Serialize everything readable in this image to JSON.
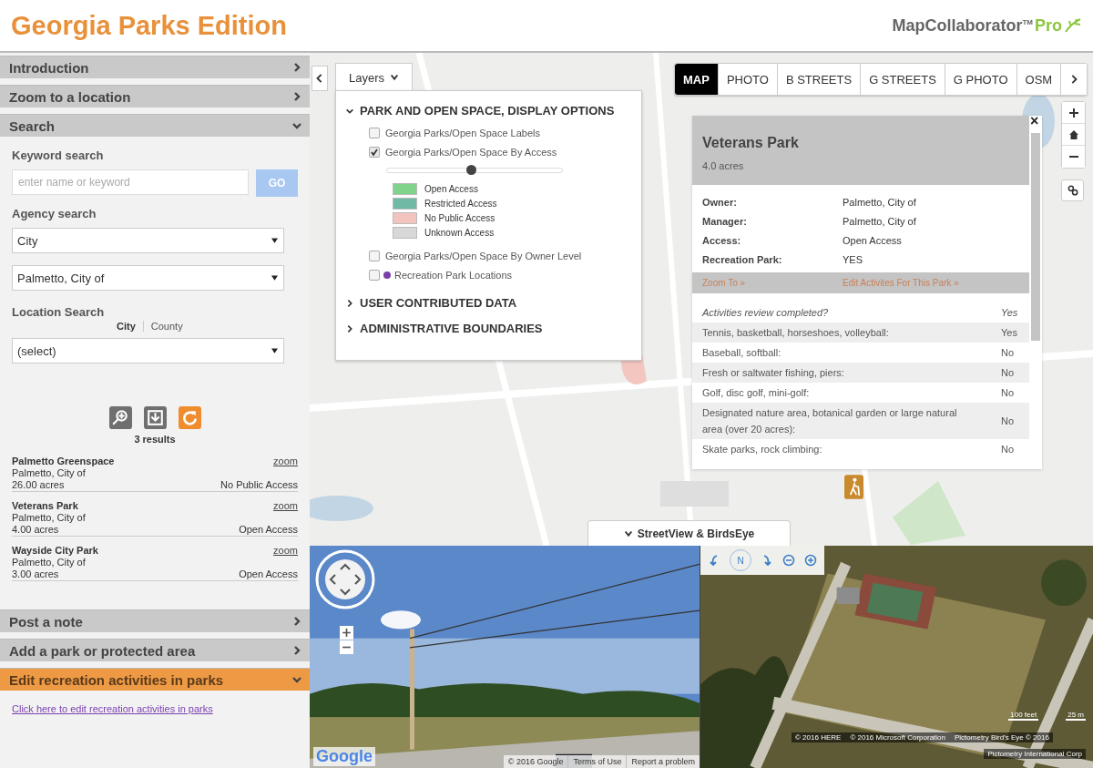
{
  "header": {
    "title": "Georgia Parks Edition",
    "logo_text": "MapCollaborator$^{TM}$",
    "logo_pro": "Pro"
  },
  "sidebar": {
    "sections": [
      {
        "title": "Introduction",
        "expanded": false,
        "active": false
      },
      {
        "title": "Zoom to a location",
        "expanded": false,
        "active": false
      },
      {
        "title": "Search",
        "expanded": true,
        "active": false,
        "kind": "search"
      },
      {
        "title": "Post a note",
        "expanded": false,
        "active": false
      },
      {
        "title": "Add a park or protected area",
        "expanded": false,
        "active": false
      },
      {
        "title": "Edit recreation activities in parks",
        "expanded": true,
        "active": true,
        "kind": "edit"
      }
    ]
  },
  "search": {
    "keyword_label": "Keyword search",
    "keyword_placeholder": "enter name or keyword",
    "go_button": "GO",
    "agency_label": "Agency search",
    "agency_type": "City",
    "agency_name": "Palmetto, City of",
    "location_label": "Location Search",
    "location_toggle": [
      {
        "label": "City",
        "selected": true
      },
      {
        "label": "County",
        "selected": false
      }
    ],
    "location_value": "(select)",
    "results_count": "3 results",
    "results": [
      {
        "name": "Palmetto Greenspace",
        "agency": "Palmetto, City of",
        "acres": "26.00 acres",
        "access": "No Public Access",
        "zoom_link": "zoom"
      },
      {
        "name": "Veterans Park",
        "agency": "Palmetto, City of",
        "acres": "4.00 acres",
        "access": "Open Access",
        "zoom_link": "zoom"
      },
      {
        "name": "Wayside City Park",
        "agency": "Palmetto, City of",
        "acres": "3.00 acres",
        "access": "Open Access",
        "zoom_link": "zoom"
      }
    ]
  },
  "edit": {
    "link": "Click here to edit recreation activities in parks"
  },
  "map": {
    "basemap_tabs": [
      {
        "label": "MAP",
        "selected": true
      },
      {
        "label": "PHOTO",
        "selected": false
      },
      {
        "label": "B STREETS",
        "selected": false
      },
      {
        "label": "G STREETS",
        "selected": false
      },
      {
        "label": "G PHOTO",
        "selected": false
      },
      {
        "label": "OSM",
        "selected": false
      }
    ],
    "layers": {
      "button": "Layers",
      "groups": [
        {
          "title": "PARK AND OPEN SPACE, DISPLAY OPTIONS",
          "expanded": true,
          "items": [
            {
              "kind": "checkbox",
              "label": "Georgia Parks/Open Space Labels",
              "checked": false
            },
            {
              "kind": "checkbox",
              "label": "Georgia Parks/Open Space By Access",
              "checked": true,
              "level": 0.48,
              "legend": [
                {
                  "label": "Open Access",
                  "color": "#7fd38b"
                },
                {
                  "label": "Restricted Access",
                  "color": "#6fb9a5"
                },
                {
                  "label": "No Public Access",
                  "color": "#f2c4bd"
                },
                {
                  "label": "Unknown Access",
                  "color": "#d8d8d8"
                }
              ]
            },
            {
              "kind": "checkbox",
              "label": "Georgia Parks/Open Space By Owner Level",
              "checked": false
            },
            {
              "kind": "dot",
              "label": "Recreation Park Locations",
              "checked": false,
              "color": "#7b3fa8"
            }
          ]
        },
        {
          "title": "USER CONTRIBUTED DATA",
          "expanded": false
        },
        {
          "title": "ADMINISTRATIVE BOUNDARIES",
          "expanded": false
        }
      ]
    },
    "popup": {
      "title": "Veterans Park",
      "subtitle": "4.0 acres",
      "close": "×",
      "fields": [
        {
          "label": "Owner:",
          "value": "Palmetto, City of"
        },
        {
          "label": "Manager:",
          "value": "Palmetto, City of"
        },
        {
          "label": "Access:",
          "value": "Open Access"
        },
        {
          "label": "Recreation Park:",
          "value": "YES"
        }
      ],
      "links": [
        "Zoom To »",
        "Edit Activites For This Park »"
      ],
      "activities": [
        {
          "kind": "header",
          "label": "Activities review completed?",
          "value": "Yes"
        },
        {
          "kind": "row",
          "label": "Tennis, basketball, horseshoes, volleyball:",
          "value": "Yes"
        },
        {
          "kind": "row",
          "label": "Baseball, softball:",
          "value": "No"
        },
        {
          "kind": "row",
          "label": "Fresh or saltwater fishing, piers:",
          "value": "No"
        },
        {
          "kind": "row",
          "label": "Golf, disc golf, mini-golf:",
          "value": "No"
        },
        {
          "kind": "row",
          "label": "Designated nature area, botanical garden or large natural area (over 20 acres):",
          "value": "No"
        },
        {
          "kind": "row",
          "label": "Skate parks, rock climbing:",
          "value": "No"
        }
      ]
    },
    "street_toggle": "StreetView & BirdsEye"
  },
  "streetview": {
    "logo": "Google",
    "attribution": [
      "© 2016 Google",
      "Terms of Use",
      "Report a problem"
    ]
  },
  "birdseye": {
    "compass": "N",
    "scale": [
      "100 feet",
      "25 m"
    ],
    "attribution": [
      "© 2016 HERE",
      "© 2016 Microsoft Corporation",
      "Pictometry Bird's Eye © 2016"
    ],
    "attribution_2": "Pictometry International Corp"
  }
}
